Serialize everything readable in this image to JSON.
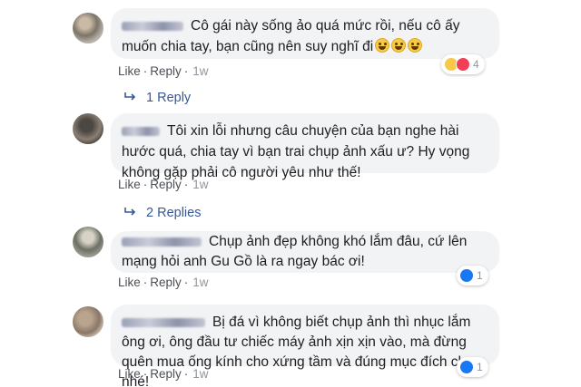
{
  "comments": [
    {
      "text": "Cô gái này sống ảo quá mức rồi, nếu cô ấy muốn chia tay, bạn cũng nên suy nghĩ đi",
      "like": "Like",
      "reply": "Reply",
      "time": "1w",
      "reactions": {
        "icons": [
          "haha-icon",
          "love-icon"
        ],
        "count": "4"
      },
      "replies": "1 Reply"
    },
    {
      "text": "Tôi xin lỗi nhưng câu chuyện của bạn nghe hài hước quá, chia tay vì bạn trai chụp ảnh xấu ư? Hy vọng không gặp phải cô người yêu như thế!",
      "like": "Like",
      "reply": "Reply",
      "time": "1w",
      "replies": "2 Replies"
    },
    {
      "text": "Chụp ảnh đẹp không khó lắm đâu, cứ lên mạng hỏi anh Gu Gồ là ra ngay bác ơi!",
      "like": "Like",
      "reply": "Reply",
      "time": "1w",
      "reactions": {
        "icons": [
          "like-icon"
        ],
        "count": "1"
      }
    },
    {
      "text": "Bị đá vì không biết chụp ảnh thì nhục lắm ông ơi, ông đầu tư chiếc máy ảnh xịn xịn vào, mà đừng quên mua ống kính cho xứng tầm và đúng mục đích chụp nhé!",
      "like": "Like",
      "reply": "Reply",
      "time": "1w",
      "reactions": {
        "icons": [
          "like-icon"
        ],
        "count": "1"
      }
    }
  ],
  "colors": {
    "bubble": "#f2f3f5",
    "link": "#365899",
    "meta": "#90949c",
    "like": "#1877f2",
    "love": "#f33e58",
    "haha": "#f7c948"
  }
}
